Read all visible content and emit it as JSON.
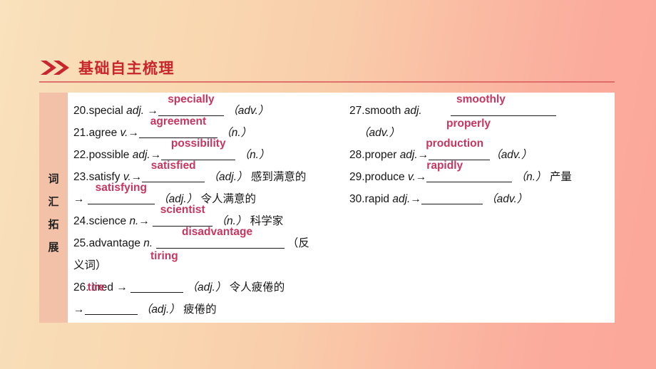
{
  "header": {
    "icon": "double-chevron-right-icon",
    "title": "基础自主梳理",
    "accent_color": "#c9252c",
    "rule_color": "#d9605f"
  },
  "card": {
    "sidebar_label": "词汇拓展",
    "sidebar_chars": [
      "词",
      "汇",
      "拓",
      "展"
    ],
    "sidebar_color": "#f3c0a8",
    "answer_color": "#c8355f",
    "background": "#ffffff"
  },
  "left_column": {
    "rows": [
      {
        "number": "20.",
        "word": "special",
        "pos": "adj.",
        "arrow": "→",
        "answer": "specially",
        "target_pos": "（adv.）",
        "meaning": ""
      },
      {
        "number": "21.",
        "word": "agree",
        "pos": "v.",
        "arrow": "→",
        "answer": "agreement",
        "target_pos": "（n.）",
        "meaning": ""
      },
      {
        "number": "22.",
        "word": "possible",
        "pos": "adj.",
        "arrow": "→",
        "answer": "possibility",
        "target_pos": "（n.）",
        "meaning": ""
      },
      {
        "number": "23.",
        "word": "satisfy",
        "pos": "v.",
        "arrow": "→",
        "answer": "satisfied",
        "target_pos": "（adj.）",
        "meaning": "感到满意的"
      },
      {
        "number": "",
        "word": "",
        "pos": "",
        "arrow": "→",
        "answer": "satisfying",
        "target_pos": "（adj.）",
        "meaning": "令人满意的"
      },
      {
        "number": "24.",
        "word": "science",
        "pos": "n.",
        "arrow": "→",
        "answer": "scientist",
        "target_pos": "（n.）",
        "meaning": "科学家"
      },
      {
        "number": "25.",
        "word": "advantage",
        "pos": "n.",
        "arrow": "",
        "answer": "disadvantage",
        "target_pos": "（反",
        "meaning": ""
      },
      {
        "number": "",
        "word": "",
        "pos": "",
        "arrow": "",
        "answer": "",
        "target_pos": "义词）",
        "meaning": ""
      },
      {
        "number": "26.",
        "word": "tire",
        "word_overlay": "tired",
        "pos": "",
        "arrow": "→",
        "answer": "",
        "target_pos": "（adj.）",
        "meaning": "令人疲倦的"
      },
      {
        "number": "",
        "word": "",
        "pos": "",
        "arrow": "→",
        "answer": "",
        "target_pos": "（adj.）",
        "meaning": "疲倦的"
      }
    ],
    "floating_notes": [
      {
        "text": "tiring"
      }
    ]
  },
  "right_column": {
    "rows": [
      {
        "number": "27.",
        "word": "smooth",
        "pos": "adj.",
        "arrow": "",
        "answer": "smoothly",
        "target_pos": "",
        "meaning": ""
      },
      {
        "number": "",
        "word": "",
        "pos": "",
        "arrow": "",
        "answer": "",
        "target_pos": "（adv.）",
        "meaning": ""
      },
      {
        "number": "28.",
        "word": "proper",
        "pos": "adj.",
        "arrow": "→",
        "answer": "production",
        "target_pos": "（adv.）",
        "meaning": ""
      },
      {
        "number": "29.",
        "word": "produce",
        "pos": "v.",
        "arrow": "→",
        "answer": "rapidly",
        "target_pos": "（n.）",
        "meaning": "产量"
      },
      {
        "number": "30.",
        "word": "rapid",
        "pos": "adj.",
        "arrow": "→",
        "answer": "",
        "target_pos": "（adv.）",
        "meaning": ""
      }
    ],
    "floating_notes": [
      {
        "text": "properly"
      }
    ]
  }
}
